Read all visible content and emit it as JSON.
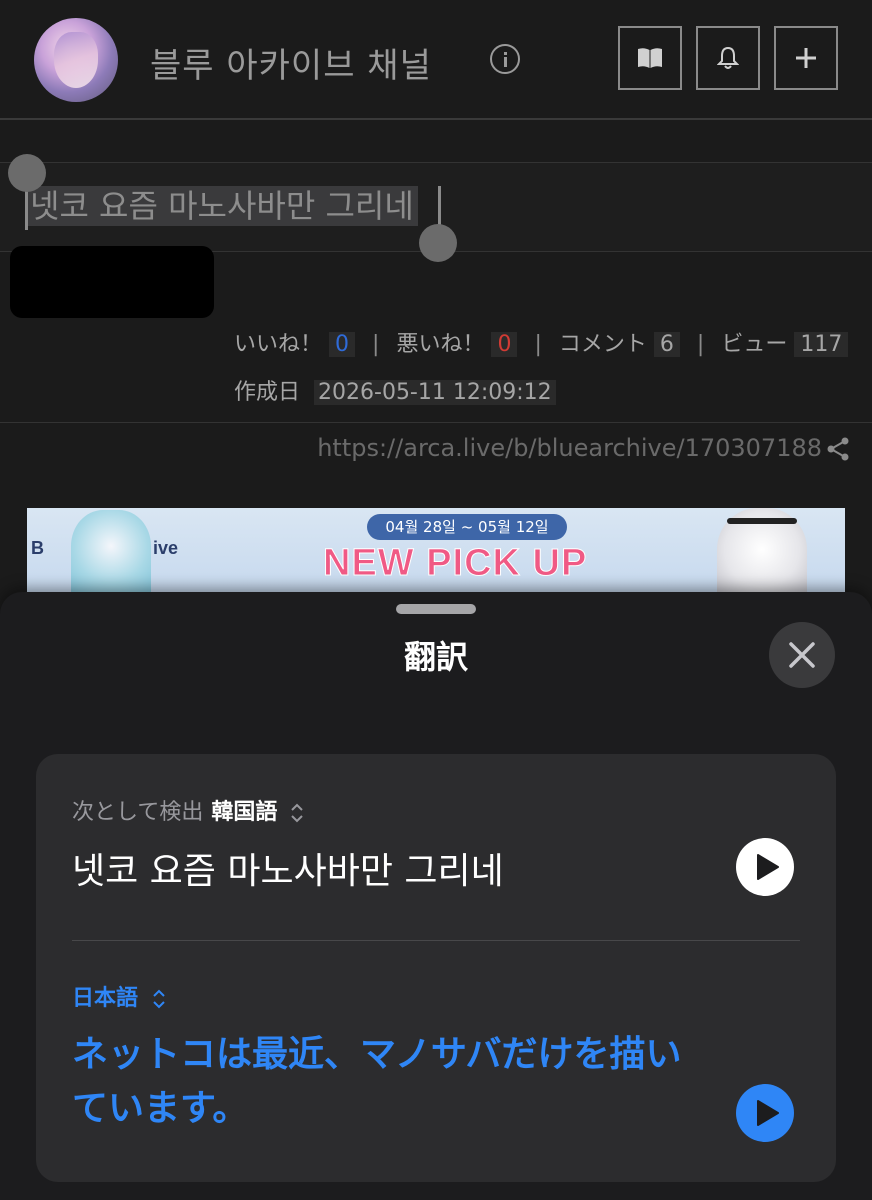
{
  "header": {
    "channel_title": "블루 아카이브 채널",
    "buttons": [
      "book-icon",
      "bell-icon",
      "plus-icon"
    ]
  },
  "article": {
    "title": "넷코 요즘 마노사바만 그리네",
    "stats": {
      "likes_label": "いいね！",
      "likes": "0",
      "dislikes_label": "悪いね！",
      "dislikes": "0",
      "comments_label": "コメント",
      "comments": "6",
      "views_label": "ビュー",
      "views": "117",
      "separator": "|"
    },
    "date_label": "作成日",
    "date_value": "2026-05-11 12:09:12",
    "url": "https://arca.live/b/bluearchive/170307188",
    "banner": {
      "dates": "04월 28일 ~ 05월 12일",
      "headline": "NEW PICK UP",
      "brand_letter": "B",
      "brand_suffix": "ive"
    }
  },
  "translate": {
    "title": "翻訳",
    "detected_prefix": "次として検出",
    "detected_language": "韓国語",
    "source_text": "넷코 요즘 마노사바만 그리네",
    "target_language": "日本語",
    "target_text": "ネットコは最近、マノサバだけを描いています。",
    "colors": {
      "accent": "#2f86f6",
      "sheet": "#1c1c1e",
      "card": "#2c2c2e"
    }
  }
}
